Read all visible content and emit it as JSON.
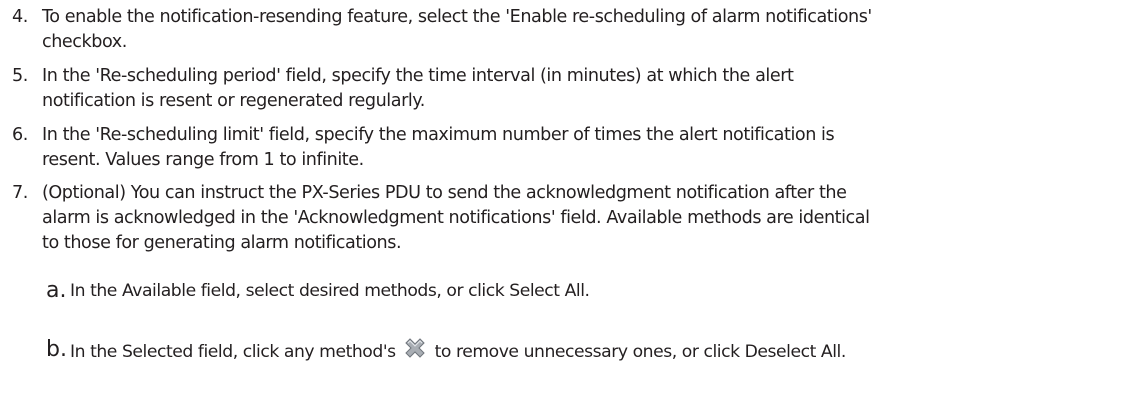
{
  "steps": [
    {
      "number": "4.",
      "lines": [
        "To enable the notification-resending feature, select the 'Enable re-scheduling of alarm notifications'",
        "checkbox."
      ]
    },
    {
      "number": "5.",
      "lines": [
        "In the 'Re-scheduling period' field, specify the time interval (in minutes) at which the alert",
        "notification is resent or regenerated regularly."
      ]
    },
    {
      "number": "6.",
      "lines": [
        "In the 'Re-scheduling limit' field, specify the maximum number of times the alert notification is",
        "resent. Values range from 1 to infinite."
      ]
    },
    {
      "number": "7.",
      "lines": [
        "(Optional) You can instruct the PX-Series PDU to send the acknowledgment notification after the",
        "alarm is acknowledged in the 'Acknowledgment notifications' field. Available methods are identical",
        "to those for generating alarm notifications."
      ]
    }
  ],
  "substeps": [
    {
      "letter": "a.",
      "text": "In the Available field, select desired methods, or click Select All."
    },
    {
      "letter": "b.",
      "text_before": "In the Selected field, click any method's",
      "text_after": "to remove unnecessary ones, or click Deselect All.",
      "icon": "remove-x-icon"
    }
  ]
}
